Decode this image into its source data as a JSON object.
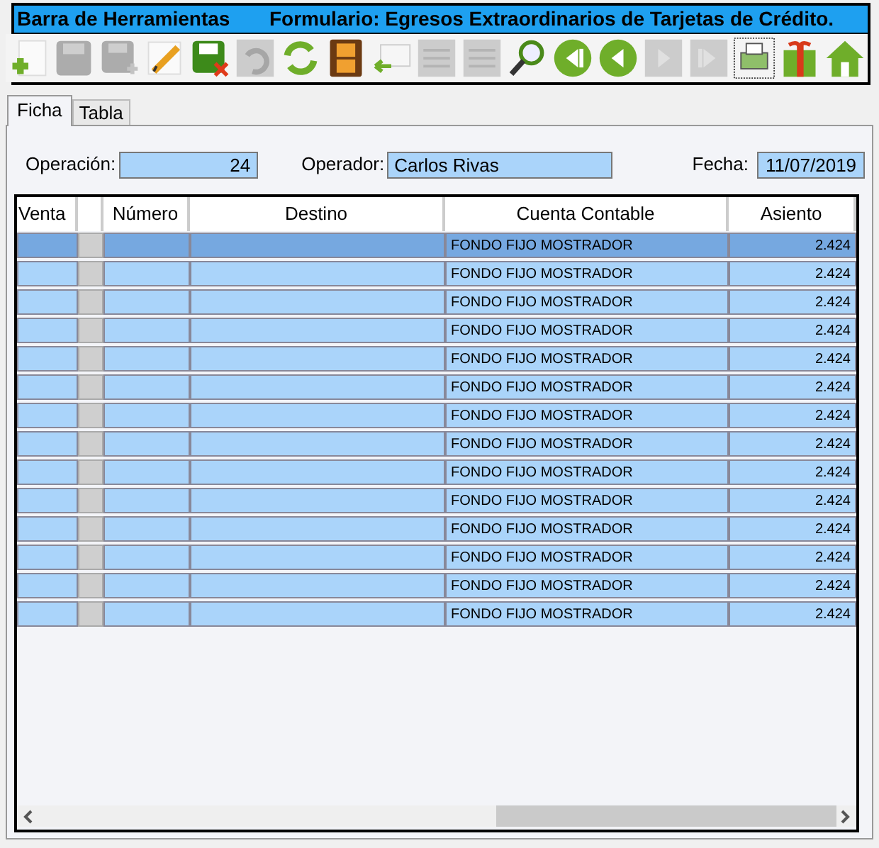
{
  "title_bar": {
    "left": "Barra de Herramientas",
    "title": "Formulario: Egresos Extraordinarios de Tarjetas de Crédito."
  },
  "toolbar": [
    {
      "kind": "new",
      "disabled": false
    },
    {
      "kind": "save",
      "disabled": true
    },
    {
      "kind": "save-as",
      "disabled": true
    },
    {
      "kind": "edit",
      "disabled": false
    },
    {
      "kind": "save-cancel",
      "disabled": false
    },
    {
      "kind": "undo",
      "disabled": true
    },
    {
      "kind": "refresh",
      "disabled": false
    },
    {
      "kind": "film",
      "disabled": false
    },
    {
      "kind": "mail",
      "disabled": false
    },
    {
      "kind": "list",
      "disabled": true
    },
    {
      "kind": "list",
      "disabled": true
    },
    {
      "kind": "search",
      "disabled": false
    },
    {
      "kind": "first",
      "disabled": false
    },
    {
      "kind": "prev",
      "disabled": false
    },
    {
      "kind": "next",
      "disabled": true
    },
    {
      "kind": "last",
      "disabled": true
    },
    {
      "kind": "print",
      "disabled": false
    },
    {
      "kind": "gift",
      "disabled": false
    },
    {
      "kind": "home",
      "disabled": false
    }
  ],
  "tabs": [
    {
      "label": "Ficha",
      "selected": true
    },
    {
      "label": "Tabla",
      "selected": false
    }
  ],
  "fields": {
    "operacion": {
      "label": "Operación:",
      "value": "24"
    },
    "operador": {
      "label": "Operador:",
      "value": "Carlos Rivas"
    },
    "fecha": {
      "label": "Fecha:",
      "value": "11/07/2019"
    }
  },
  "table": {
    "columns": [
      "Venta",
      "",
      "Número",
      "Destino",
      "Cuenta Contable",
      "Asiento"
    ],
    "rows": [
      {
        "selected": true,
        "cuenta": "FONDO FIJO MOSTRADOR",
        "asiento": "2.424"
      },
      {
        "selected": false,
        "cuenta": "FONDO FIJO MOSTRADOR",
        "asiento": "2.424"
      },
      {
        "selected": false,
        "cuenta": "FONDO FIJO MOSTRADOR",
        "asiento": "2.424"
      },
      {
        "selected": false,
        "cuenta": "FONDO FIJO MOSTRADOR",
        "asiento": "2.424"
      },
      {
        "selected": false,
        "cuenta": "FONDO FIJO MOSTRADOR",
        "asiento": "2.424"
      },
      {
        "selected": false,
        "cuenta": "FONDO FIJO MOSTRADOR",
        "asiento": "2.424"
      },
      {
        "selected": false,
        "cuenta": "FONDO FIJO MOSTRADOR",
        "asiento": "2.424"
      },
      {
        "selected": false,
        "cuenta": "FONDO FIJO MOSTRADOR",
        "asiento": "2.424"
      },
      {
        "selected": false,
        "cuenta": "FONDO FIJO MOSTRADOR",
        "asiento": "2.424"
      },
      {
        "selected": false,
        "cuenta": "FONDO FIJO MOSTRADOR",
        "asiento": "2.424"
      },
      {
        "selected": false,
        "cuenta": "FONDO FIJO MOSTRADOR",
        "asiento": "2.424"
      },
      {
        "selected": false,
        "cuenta": "FONDO FIJO MOSTRADOR",
        "asiento": "2.424"
      },
      {
        "selected": false,
        "cuenta": "FONDO FIJO MOSTRADOR",
        "asiento": "2.424"
      },
      {
        "selected": false,
        "cuenta": "FONDO FIJO MOSTRADOR",
        "asiento": "2.424"
      }
    ]
  }
}
